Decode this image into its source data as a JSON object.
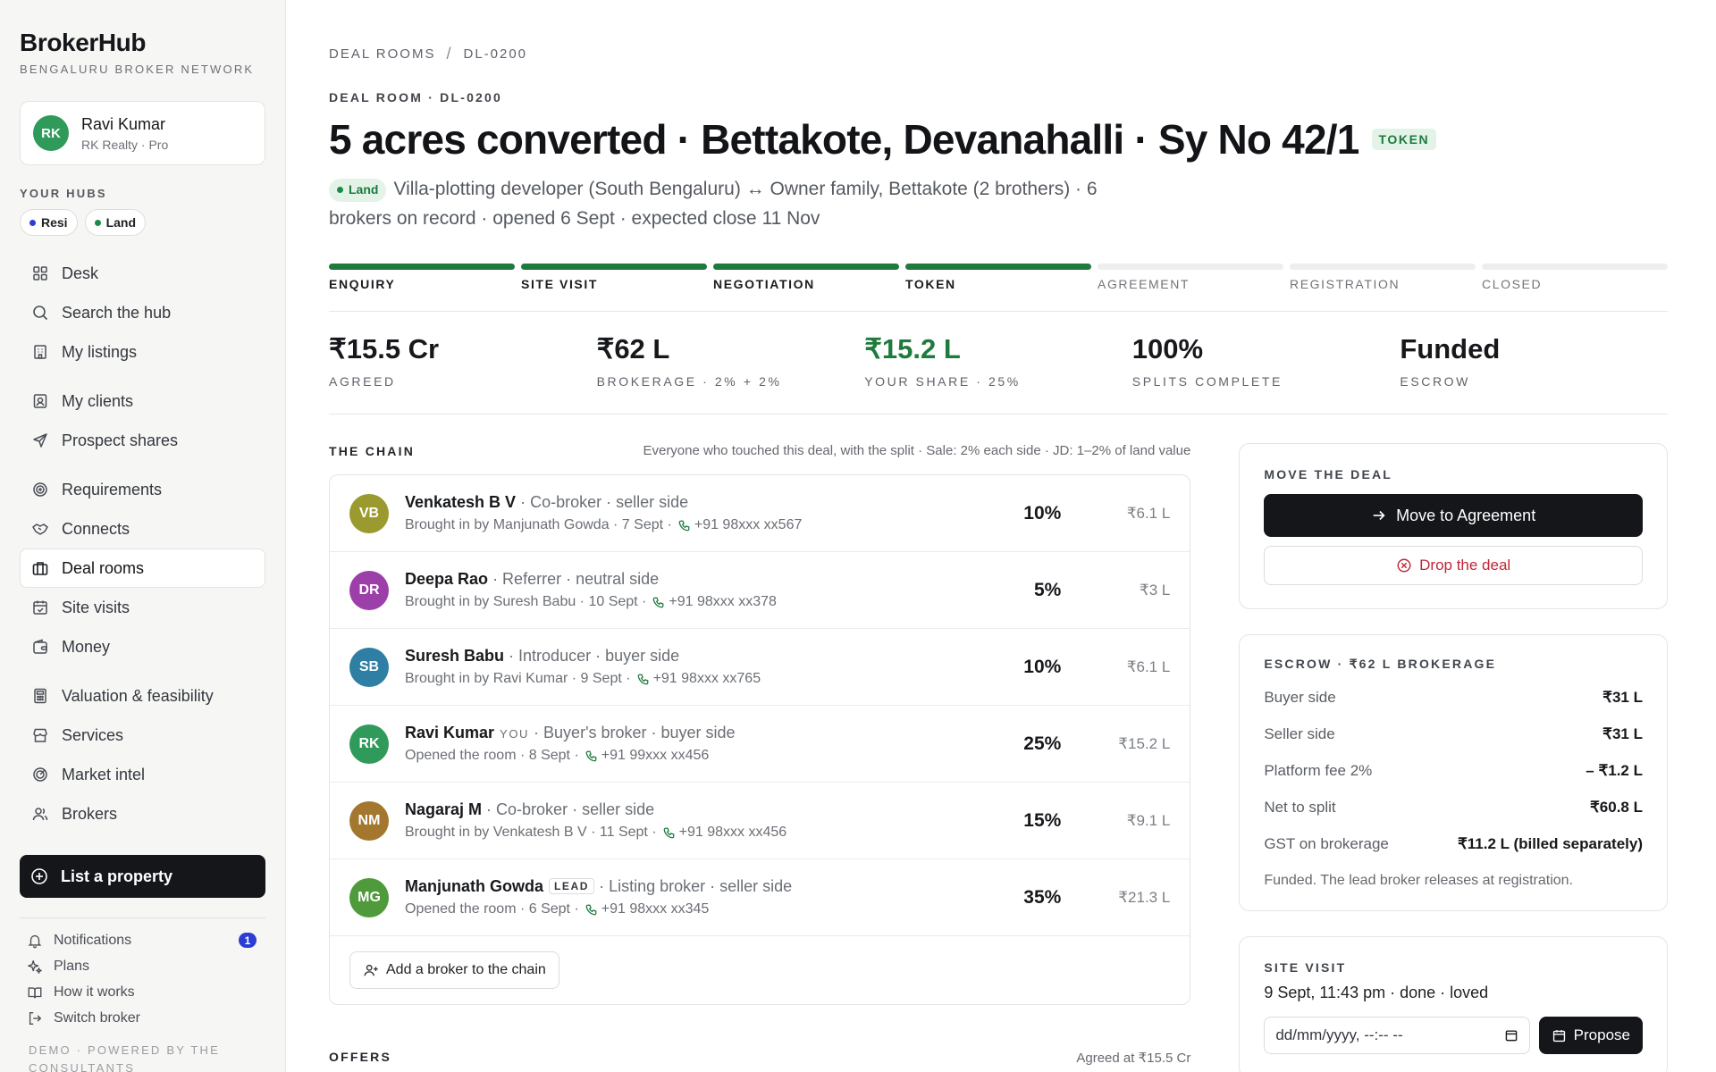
{
  "brand": {
    "name": "BrokerHub",
    "tagline": "BENGALURU BROKER NETWORK"
  },
  "user": {
    "initials": "RK",
    "name": "Ravi Kumar",
    "sub": "RK Realty · Pro",
    "avatar_color": "#2f9a5a"
  },
  "hubs": {
    "label": "YOUR HUBS",
    "items": [
      {
        "label": "Resi",
        "dot_color": "#2b3ed4"
      },
      {
        "label": "Land",
        "dot_color": "#1f8a47"
      }
    ]
  },
  "nav": {
    "group1": [
      {
        "label": "Desk",
        "icon": "grid-icon"
      },
      {
        "label": "Search the hub",
        "icon": "search-icon"
      },
      {
        "label": "My listings",
        "icon": "building-icon"
      }
    ],
    "group2": [
      {
        "label": "My clients",
        "icon": "contact-icon"
      },
      {
        "label": "Prospect shares",
        "icon": "send-icon"
      }
    ],
    "group3": [
      {
        "label": "Requirements",
        "icon": "target-icon"
      },
      {
        "label": "Connects",
        "icon": "handshake-icon"
      },
      {
        "label": "Deal rooms",
        "icon": "briefcase-icon"
      },
      {
        "label": "Site visits",
        "icon": "calendar-check-icon"
      },
      {
        "label": "Money",
        "icon": "wallet-icon"
      }
    ],
    "group4": [
      {
        "label": "Valuation & feasibility",
        "icon": "calculator-icon"
      },
      {
        "label": "Services",
        "icon": "store-icon"
      },
      {
        "label": "Market intel",
        "icon": "radar-icon"
      },
      {
        "label": "Brokers",
        "icon": "users-icon"
      }
    ],
    "active": "Deal rooms",
    "list_property": "List a property"
  },
  "footer_nav": {
    "items": [
      {
        "label": "Notifications",
        "icon": "bell-icon"
      },
      {
        "label": "Plans",
        "icon": "sparkle-icon"
      },
      {
        "label": "How it works",
        "icon": "book-icon"
      },
      {
        "label": "Switch broker",
        "icon": "logout-icon"
      }
    ],
    "notification_count": "1",
    "demo": "DEMO · POWERED BY THE CONSULTANTS"
  },
  "breadcrumb": {
    "parent": "DEAL ROOMS",
    "sep": "/",
    "current": "DL-0200"
  },
  "deal": {
    "eyebrow": "DEAL ROOM · DL-0200",
    "title": "5 acres converted · Bettakote, Devanahalli · Sy No 42/1",
    "status_badge": "TOKEN",
    "type_badge": "Land",
    "description": "Villa-plotting developer (South Bengaluru) ↔ Owner family, Bettakote (2 brothers) · 6 brokers on record · opened 6 Sept · expected close 11 Nov"
  },
  "stages": {
    "items": [
      "ENQUIRY",
      "SITE VISIT",
      "NEGOTIATION",
      "TOKEN",
      "AGREEMENT",
      "REGISTRATION",
      "CLOSED"
    ],
    "completed_count": 4
  },
  "stats": [
    {
      "value": "₹15.5 Cr",
      "label": "AGREED"
    },
    {
      "value": "₹62 L",
      "label": "BROKERAGE · 2% + 2%"
    },
    {
      "value": "₹15.2 L",
      "label": "YOUR SHARE · 25%",
      "highlight": true
    },
    {
      "value": "100%",
      "label": "SPLITS COMPLETE"
    },
    {
      "value": "Funded",
      "label": "ESCROW"
    }
  ],
  "chain": {
    "title": "THE CHAIN",
    "note": "Everyone who touched this deal, with the split · Sale: 2% each side · JD: 1–2% of land value",
    "rows": [
      {
        "initials": "VB",
        "color": "#9a9a2e",
        "name": "Venkatesh B V",
        "tag": "",
        "role": "· Co-broker · seller side",
        "origin": "Brought in by Manjunath Gowda · 7 Sept ·",
        "phone": "+91 98xxx xx567",
        "pct": "10%",
        "amt": "₹6.1 L"
      },
      {
        "initials": "DR",
        "color": "#9c3fa8",
        "name": "Deepa Rao",
        "tag": "",
        "role": "· Referrer · neutral side",
        "origin": "Brought in by Suresh Babu · 10 Sept ·",
        "phone": "+91 98xxx xx378",
        "pct": "5%",
        "amt": "₹3 L"
      },
      {
        "initials": "SB",
        "color": "#2e7fa3",
        "name": "Suresh Babu",
        "tag": "",
        "role": "· Introducer · buyer side",
        "origin": "Brought in by Ravi Kumar · 9 Sept ·",
        "phone": "+91 98xxx xx765",
        "pct": "10%",
        "amt": "₹6.1 L"
      },
      {
        "initials": "RK",
        "color": "#2f9a5a",
        "name": "Ravi Kumar",
        "tag": "YOU",
        "role": "· Buyer's broker · buyer side",
        "origin": "Opened the room · 8 Sept ·",
        "phone": "+91 99xxx xx456",
        "pct": "25%",
        "amt": "₹15.2 L"
      },
      {
        "initials": "NM",
        "color": "#a3782e",
        "name": "Nagaraj M",
        "tag": "",
        "role": "· Co-broker · seller side",
        "origin": "Brought in by Venkatesh B V · 11 Sept ·",
        "phone": "+91 98xxx xx456",
        "pct": "15%",
        "amt": "₹9.1 L"
      },
      {
        "initials": "MG",
        "color": "#4f9a3a",
        "name": "Manjunath Gowda",
        "tag": "LEAD",
        "role": "· Listing broker · seller side",
        "origin": "Opened the room · 6 Sept ·",
        "phone": "+91 98xxx xx345",
        "pct": "35%",
        "amt": "₹21.3 L"
      }
    ],
    "add_label": "Add a broker to the chain"
  },
  "offers": {
    "title": "OFFERS",
    "note": "Agreed at ₹15.5 Cr"
  },
  "move": {
    "title": "MOVE THE DEAL",
    "primary": "Move to Agreement",
    "secondary": "Drop the deal"
  },
  "escrow": {
    "title": "ESCROW · ₹62 L BROKERAGE",
    "rows": [
      {
        "label": "Buyer side",
        "value": "₹31 L"
      },
      {
        "label": "Seller side",
        "value": "₹31 L"
      },
      {
        "label": "Platform fee 2%",
        "value": "– ₹1.2 L"
      },
      {
        "label": "Net to split",
        "value": "₹60.8 L"
      },
      {
        "label": "GST on brokerage",
        "value": "₹11.2 L (billed separately)"
      }
    ],
    "note": "Funded. The lead broker releases at registration."
  },
  "site_visit": {
    "title": "SITE VISIT",
    "line": "9 Sept, 11:43 pm · done · loved",
    "input_placeholder": "dd/mm/yyyy, --:-- --",
    "propose": "Propose"
  },
  "colors": {
    "accent_green": "#1f7a3d",
    "dark": "#14161a",
    "danger": "#c0263a",
    "badge_blue": "#2b3ed4"
  }
}
